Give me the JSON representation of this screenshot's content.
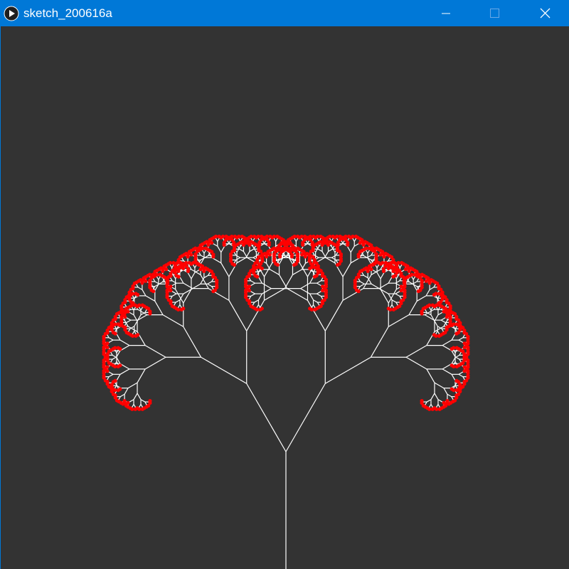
{
  "window": {
    "title": "sketch_200616a",
    "controls": {
      "minimize": "minimize",
      "maximize": "maximize",
      "close": "close"
    }
  },
  "icons": {
    "app": "processing-play-icon",
    "minimize": "minimize-icon",
    "maximize": "maximize-icon",
    "close": "close-icon"
  },
  "colors": {
    "titlebar": "#0078d7",
    "canvas_background": "#333333",
    "branch": "#ffffff",
    "leaf": "#ff0000"
  },
  "sketch": {
    "type": "fractal-tree",
    "recursion_depth": 10,
    "branch_angle_degrees": 30,
    "length_ratio": 0.67
  }
}
